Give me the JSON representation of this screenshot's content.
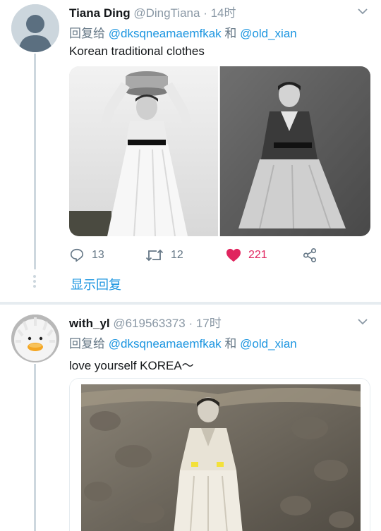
{
  "tweets": [
    {
      "name": "Tiana Ding",
      "handle": "@DingTiana",
      "time": "· 14时",
      "reply_prefix": "回复给",
      "mention1": "@dksqneamaemfkak",
      "conj": "和",
      "mention2": "@old_xian",
      "text": "Korean traditional clothes",
      "replies": "13",
      "retweets": "12",
      "likes": "221",
      "show_replies": "显示回复",
      "avatar": "default-avatar-icon"
    },
    {
      "name": "with_yl",
      "handle": "@619563373",
      "time": "· 17时",
      "reply_prefix": "回复给",
      "mention1": "@dksqneamaemfkak",
      "conj": "和",
      "mention2": "@old_xian",
      "text": "love yourself KOREA～",
      "avatar": "fluffy-duck-avatar"
    }
  ],
  "colors": {
    "link": "#1b95e0",
    "muted": "#657786",
    "like": "#e0245e",
    "divider": "#e6ecf0"
  }
}
